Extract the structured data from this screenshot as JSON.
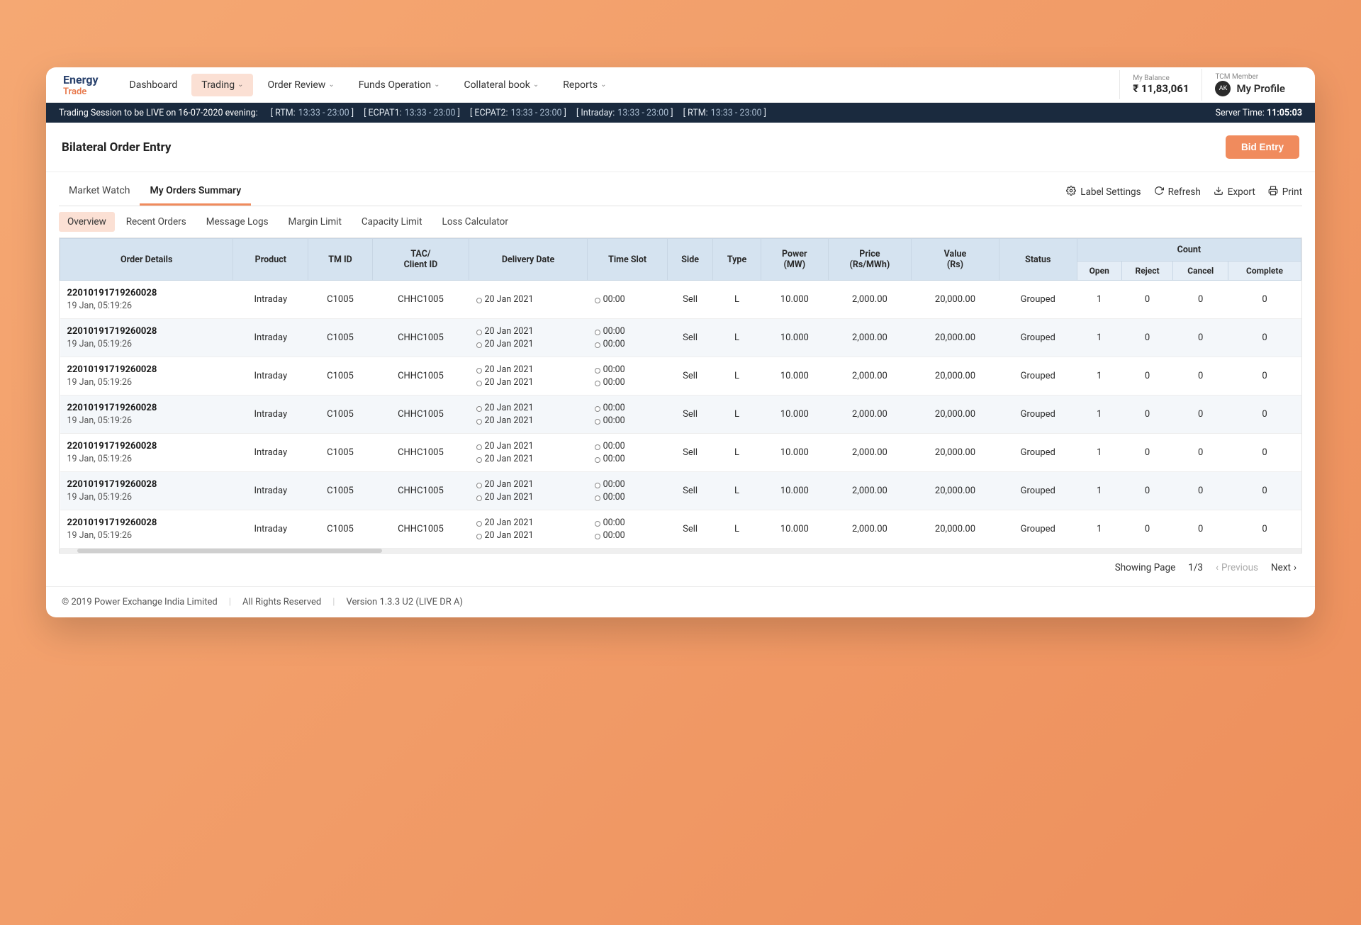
{
  "logo": {
    "line1": "Energy",
    "line2": "Trade"
  },
  "nav": [
    {
      "label": "Dashboard",
      "dropdown": false,
      "active": false
    },
    {
      "label": "Trading",
      "dropdown": true,
      "active": true
    },
    {
      "label": "Order Review",
      "dropdown": true,
      "active": false
    },
    {
      "label": "Funds Operation",
      "dropdown": true,
      "active": false
    },
    {
      "label": "Collateral book",
      "dropdown": true,
      "active": false
    },
    {
      "label": "Reports",
      "dropdown": true,
      "active": false
    }
  ],
  "balance": {
    "label": "My Balance",
    "value": "₹ 11,83,061"
  },
  "profile": {
    "label": "TCM Member",
    "initials": "AK",
    "name": "My Profile"
  },
  "sessionBar": {
    "message": "Trading Session to be LIVE on 16-07-2020 evening:",
    "slots": [
      {
        "name": "RTM:",
        "time": "13:33 - 23:00"
      },
      {
        "name": "ECPAT1:",
        "time": "13:33 - 23:00"
      },
      {
        "name": "ECPAT2:",
        "time": "13:33 - 23:00"
      },
      {
        "name": "Intraday:",
        "time": "13:33 - 23:00"
      },
      {
        "name": "RTM:",
        "time": "13:33 - 23:00"
      }
    ],
    "serverLabel": "Server Time:",
    "serverTime": "11:05:03"
  },
  "page": {
    "title": "Bilateral Order Entry",
    "bidButton": "Bid Entry"
  },
  "mainTabs": [
    {
      "label": "Market Watch",
      "active": false
    },
    {
      "label": "My Orders Summary",
      "active": true
    }
  ],
  "actions": {
    "labelSettings": "Label Settings",
    "refresh": "Refresh",
    "export": "Export",
    "print": "Print"
  },
  "subTabs": [
    {
      "label": "Overview",
      "active": true
    },
    {
      "label": "Recent Orders",
      "active": false
    },
    {
      "label": "Message Logs",
      "active": false
    },
    {
      "label": "Margin Limit",
      "active": false
    },
    {
      "label": "Capacity Limit",
      "active": false
    },
    {
      "label": "Loss Calculator",
      "active": false
    }
  ],
  "columns": {
    "orderDetails": "Order Details",
    "product": "Product",
    "tmId": "TM ID",
    "tacClient": "TAC/\nClient ID",
    "deliveryDate": "Delivery Date",
    "timeSlot": "Time Slot",
    "side": "Side",
    "type": "Type",
    "power": "Power\n(MW)",
    "price": "Price\n(Rs/MWh)",
    "value": "Value\n(Rs)",
    "status": "Status",
    "count": "Count",
    "open": "Open",
    "reject": "Reject",
    "cancel": "Cancel",
    "complete": "Complete"
  },
  "rows": [
    {
      "orderId": "22010191719260028",
      "ts": "19 Jan, 05:19:26",
      "product": "Intraday",
      "tmId": "C1005",
      "clientId": "CHHC1005",
      "delivery": [
        "20 Jan 2021"
      ],
      "slot": [
        "00:00"
      ],
      "side": "Sell",
      "type": "L",
      "power": "10.000",
      "price": "2,000.00",
      "value": "20,000.00",
      "status": "Grouped",
      "open": "1",
      "reject": "0",
      "cancel": "0",
      "complete": "0"
    },
    {
      "orderId": "22010191719260028",
      "ts": "19 Jan, 05:19:26",
      "product": "Intraday",
      "tmId": "C1005",
      "clientId": "CHHC1005",
      "delivery": [
        "20 Jan 2021",
        "20 Jan 2021"
      ],
      "slot": [
        "00:00",
        "00:00"
      ],
      "side": "Sell",
      "type": "L",
      "power": "10.000",
      "price": "2,000.00",
      "value": "20,000.00",
      "status": "Grouped",
      "open": "1",
      "reject": "0",
      "cancel": "0",
      "complete": "0"
    },
    {
      "orderId": "22010191719260028",
      "ts": "19 Jan, 05:19:26",
      "product": "Intraday",
      "tmId": "C1005",
      "clientId": "CHHC1005",
      "delivery": [
        "20 Jan 2021",
        "20 Jan 2021"
      ],
      "slot": [
        "00:00",
        "00:00"
      ],
      "side": "Sell",
      "type": "L",
      "power": "10.000",
      "price": "2,000.00",
      "value": "20,000.00",
      "status": "Grouped",
      "open": "1",
      "reject": "0",
      "cancel": "0",
      "complete": "0"
    },
    {
      "orderId": "22010191719260028",
      "ts": "19 Jan, 05:19:26",
      "product": "Intraday",
      "tmId": "C1005",
      "clientId": "CHHC1005",
      "delivery": [
        "20 Jan 2021",
        "20 Jan 2021"
      ],
      "slot": [
        "00:00",
        "00:00"
      ],
      "side": "Sell",
      "type": "L",
      "power": "10.000",
      "price": "2,000.00",
      "value": "20,000.00",
      "status": "Grouped",
      "open": "1",
      "reject": "0",
      "cancel": "0",
      "complete": "0"
    },
    {
      "orderId": "22010191719260028",
      "ts": "19 Jan, 05:19:26",
      "product": "Intraday",
      "tmId": "C1005",
      "clientId": "CHHC1005",
      "delivery": [
        "20 Jan 2021",
        "20 Jan 2021"
      ],
      "slot": [
        "00:00",
        "00:00"
      ],
      "side": "Sell",
      "type": "L",
      "power": "10.000",
      "price": "2,000.00",
      "value": "20,000.00",
      "status": "Grouped",
      "open": "1",
      "reject": "0",
      "cancel": "0",
      "complete": "0"
    },
    {
      "orderId": "22010191719260028",
      "ts": "19 Jan, 05:19:26",
      "product": "Intraday",
      "tmId": "C1005",
      "clientId": "CHHC1005",
      "delivery": [
        "20 Jan 2021",
        "20 Jan 2021"
      ],
      "slot": [
        "00:00",
        "00:00"
      ],
      "side": "Sell",
      "type": "L",
      "power": "10.000",
      "price": "2,000.00",
      "value": "20,000.00",
      "status": "Grouped",
      "open": "1",
      "reject": "0",
      "cancel": "0",
      "complete": "0"
    },
    {
      "orderId": "22010191719260028",
      "ts": "19 Jan, 05:19:26",
      "product": "Intraday",
      "tmId": "C1005",
      "clientId": "CHHC1005",
      "delivery": [
        "20 Jan 2021",
        "20 Jan 2021"
      ],
      "slot": [
        "00:00",
        "00:00"
      ],
      "side": "Sell",
      "type": "L",
      "power": "10.000",
      "price": "2,000.00",
      "value": "20,000.00",
      "status": "Grouped",
      "open": "1",
      "reject": "0",
      "cancel": "0",
      "complete": "0"
    }
  ],
  "pager": {
    "showing": "Showing Page",
    "page": "1/3",
    "prev": "Previous",
    "next": "Next"
  },
  "footer": {
    "copyright": "© 2019 Power Exchange India Limited",
    "rights": "All Rights Reserved",
    "version": "Version 1.3.3 U2 (LIVE DR A)"
  }
}
